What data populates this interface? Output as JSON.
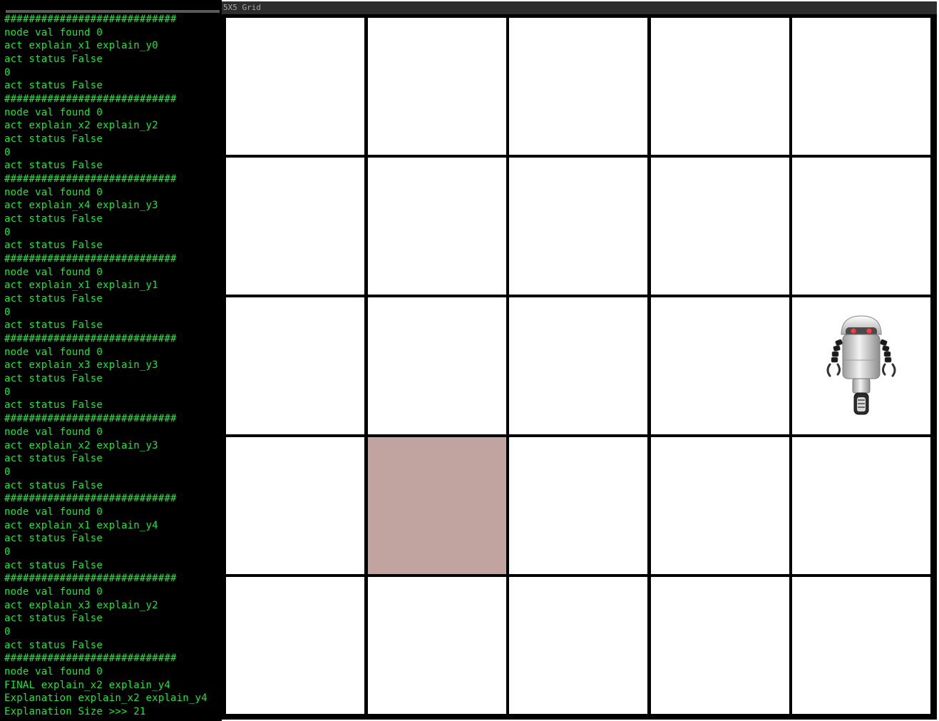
{
  "terminal": {
    "lines": [
      "############################",
      "node val found 0",
      "act explain_x1 explain_y0",
      "act status False",
      "0",
      "act status False",
      "############################",
      "node val found 0",
      "act explain_x2 explain_y2",
      "act status False",
      "0",
      "act status False",
      "############################",
      "node val found 0",
      "act explain_x4 explain_y3",
      "act status False",
      "0",
      "act status False",
      "############################",
      "node val found 0",
      "act explain_x1 explain_y1",
      "act status False",
      "0",
      "act status False",
      "############################",
      "node val found 0",
      "act explain_x3 explain_y3",
      "act status False",
      "0",
      "act status False",
      "############################",
      "node val found 0",
      "act explain_x2 explain_y3",
      "act status False",
      "0",
      "act status False",
      "############################",
      "node val found 0",
      "act explain_x1 explain_y4",
      "act status False",
      "0",
      "act status False",
      "############################",
      "node val found 0",
      "act explain_x3 explain_y2",
      "act status False",
      "0",
      "act status False",
      "############################",
      "node val found 0",
      "FINAL explain_x2 explain_y4",
      "Explanation explain_x2 explain_y4",
      "Explanation Size >>> 21"
    ],
    "text_color": "#22e33a",
    "background": "#000000"
  },
  "grid_window": {
    "title": "5X5 Grid",
    "rows": 5,
    "cols": 5,
    "cell_color": "#ffffff",
    "line_color": "#000000",
    "highlight": {
      "row": 3,
      "col": 1,
      "color": "#c1a4a0"
    },
    "robot": {
      "row": 2,
      "col": 4,
      "icon": "robot-icon"
    }
  }
}
